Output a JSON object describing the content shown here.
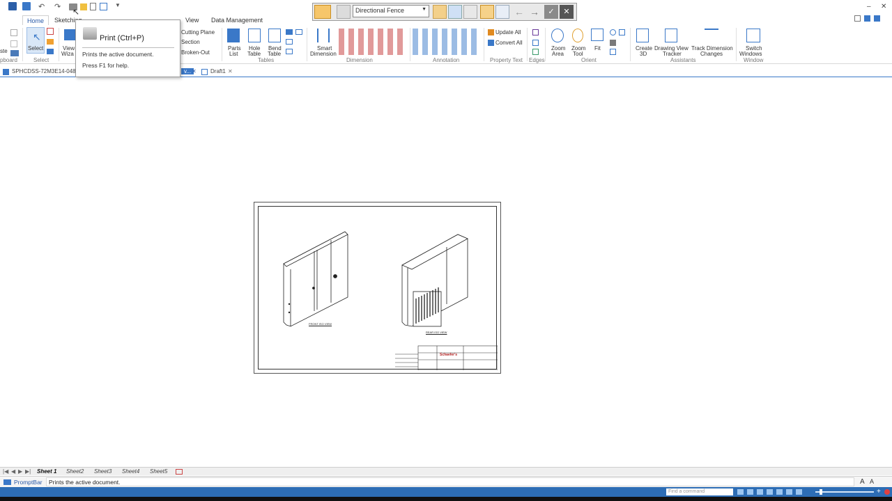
{
  "ribbon": {
    "tabs": [
      "Home",
      "Sketching",
      "View",
      "Data Management"
    ],
    "groups": {
      "clipboard": "pboard",
      "select": "Select",
      "tables": "Tables",
      "dimension": "Dimension",
      "annotation": "Annotation",
      "property_text": "Property Text",
      "edges": "Edges",
      "orient": "Orient",
      "assistants": "Assistants",
      "window": "Window"
    },
    "buttons": {
      "select": "Select",
      "view_wizard_1": "View",
      "view_wizard_2": "Wiza",
      "cutting_plane": "Cutting Plane",
      "section": "Section",
      "broken_out": "Broken-Out",
      "parts_list_1": "Parts",
      "parts_list_2": "List",
      "hole_table_1": "Hole",
      "hole_table_2": "Table",
      "bend_table_1": "Bend",
      "bend_table_2": "Table",
      "smart_dim_1": "Smart",
      "smart_dim_2": "Dimension",
      "update_all": "Update All",
      "convert_all": "Convert All",
      "zoom_area_1": "Zoom",
      "zoom_area_2": "Area",
      "zoom_tool_1": "Zoom",
      "zoom_tool_2": "Tool",
      "fit": "Fit",
      "create3d_1": "Create",
      "create3d_2": "3D",
      "dvt_1": "Drawing View",
      "dvt_2": "Tracker",
      "tdc_1": "Track Dimension",
      "tdc_2": "Changes",
      "switch_1": "Switch",
      "switch_2": "Windows"
    }
  },
  "command_bar": {
    "selection_filter": "Directional Fence"
  },
  "tooltip": {
    "title": "Print (Ctrl+P)",
    "description": "Prints the active document.",
    "help": "Press F1 for help."
  },
  "documents": {
    "tab1": "SPHCDSS-72M3E14-048...",
    "tab2": "v...",
    "tab3": "Draft1"
  },
  "drawing": {
    "view1_caption": "FRONT ISO VIEW",
    "view2_caption": "REAR ISO VIEW",
    "title_block_logo": "Schaefer's"
  },
  "sheets": [
    "Sheet 1",
    "Sheet2",
    "Sheet3",
    "Sheet4",
    "Sheet5"
  ],
  "prompt_bar": {
    "label": "PromptBar",
    "text": "Prints the active document."
  },
  "status_bar": {
    "find_placeholder": "Find a command"
  },
  "colors": {
    "accent": "#2d6db5",
    "select_highlight": "#f6c66b"
  }
}
